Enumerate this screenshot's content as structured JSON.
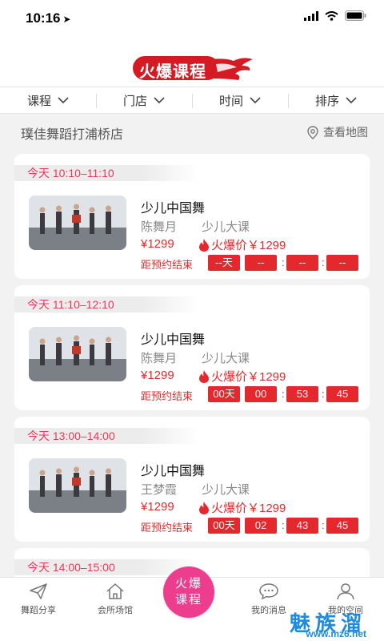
{
  "status": {
    "time": "10:16"
  },
  "header": {
    "brand": "火爆课程"
  },
  "filters": [
    {
      "label": "课程"
    },
    {
      "label": "门店"
    },
    {
      "label": "时间"
    },
    {
      "label": "排序"
    }
  ],
  "store": {
    "name": "璞佳舞蹈打浦桥店",
    "map_link": "查看地图"
  },
  "cards": [
    {
      "time": "今天 10:10–11:10",
      "course": "少儿中国舞",
      "teacher": "陈舞月",
      "type": "少儿大课",
      "price": "¥1299",
      "hot_price": "火爆价￥1299",
      "countdown_label": "距预约结束",
      "countdown": [
        "--天",
        "--",
        "--",
        "--"
      ]
    },
    {
      "time": "今天 11:10–12:10",
      "course": "少儿中国舞",
      "teacher": "陈舞月",
      "type": "少儿大课",
      "price": "¥1299",
      "hot_price": "火爆价￥1299",
      "countdown_label": "距预约结束",
      "countdown": [
        "00天",
        "00",
        "53",
        "45"
      ]
    },
    {
      "time": "今天 13:00–14:00",
      "course": "少儿中国舞",
      "teacher": "王梦霞",
      "type": "少儿大课",
      "price": "¥1299",
      "hot_price": "火爆价￥1299",
      "countdown_label": "距预约结束",
      "countdown": [
        "00天",
        "02",
        "43",
        "45"
      ]
    },
    {
      "time": "今天 14:00–15:00"
    }
  ],
  "tabbar": {
    "items": [
      {
        "label": "舞蹈分享"
      },
      {
        "label": "会所场馆"
      },
      {
        "label": "火爆课程"
      },
      {
        "label": "我的消息"
      },
      {
        "label": "我的空间"
      }
    ],
    "center_line1": "火爆",
    "center_line2": "课程"
  },
  "watermark": {
    "text": "魅族溜",
    "url": "www.mz6.net"
  },
  "colors": {
    "accent": "#e4292e",
    "pink": "#ec3d8f",
    "time_text": "#e8395a"
  }
}
